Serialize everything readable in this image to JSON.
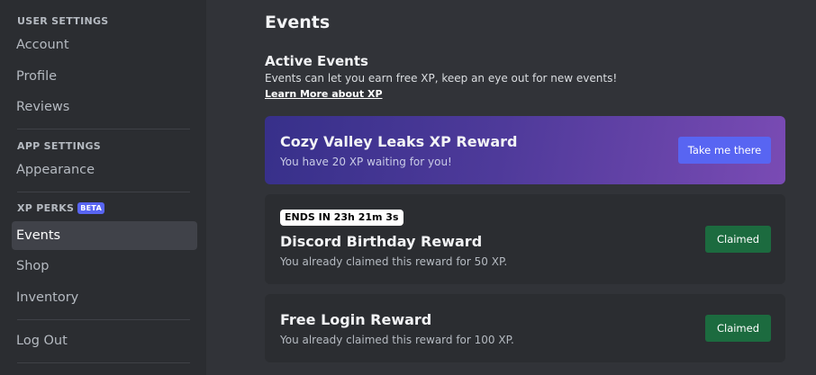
{
  "sidebar": {
    "user_settings_header": "USER SETTINGS",
    "user_items": [
      "Account",
      "Profile",
      "Reviews"
    ],
    "app_settings_header": "APP SETTINGS",
    "app_items": [
      "Appearance"
    ],
    "xp_perks_header": "XP PERKS",
    "xp_perks_badge": "BETA",
    "xp_items": [
      "Events",
      "Shop",
      "Inventory"
    ],
    "selected": "Events",
    "logout": "Log Out"
  },
  "main": {
    "title": "Events",
    "active_events": {
      "title": "Active Events",
      "description": "Events can let you earn free XP, keep an eye out for new events!",
      "learn_more": "Learn More about XP"
    },
    "cards": [
      {
        "title": "Cozy Valley Leaks XP Reward",
        "subtitle": "You have 20 XP waiting for you!",
        "button": "Take me there"
      },
      {
        "badge": "ENDS IN 23h 21m 3s",
        "title": "Discord Birthday Reward",
        "subtitle": "You already claimed this reward for 50 XP.",
        "button": "Claimed"
      },
      {
        "title": "Free Login Reward",
        "subtitle": "You already claimed this reward for 100 XP.",
        "button": "Claimed"
      }
    ]
  },
  "colors": {
    "background": "#313338",
    "sidebar": "#2b2d31",
    "accent": "#5865f2",
    "claimed": "#1c6b3f",
    "promo_gradient_start": "#37308a",
    "promo_gradient_end": "#7a4bb4"
  }
}
